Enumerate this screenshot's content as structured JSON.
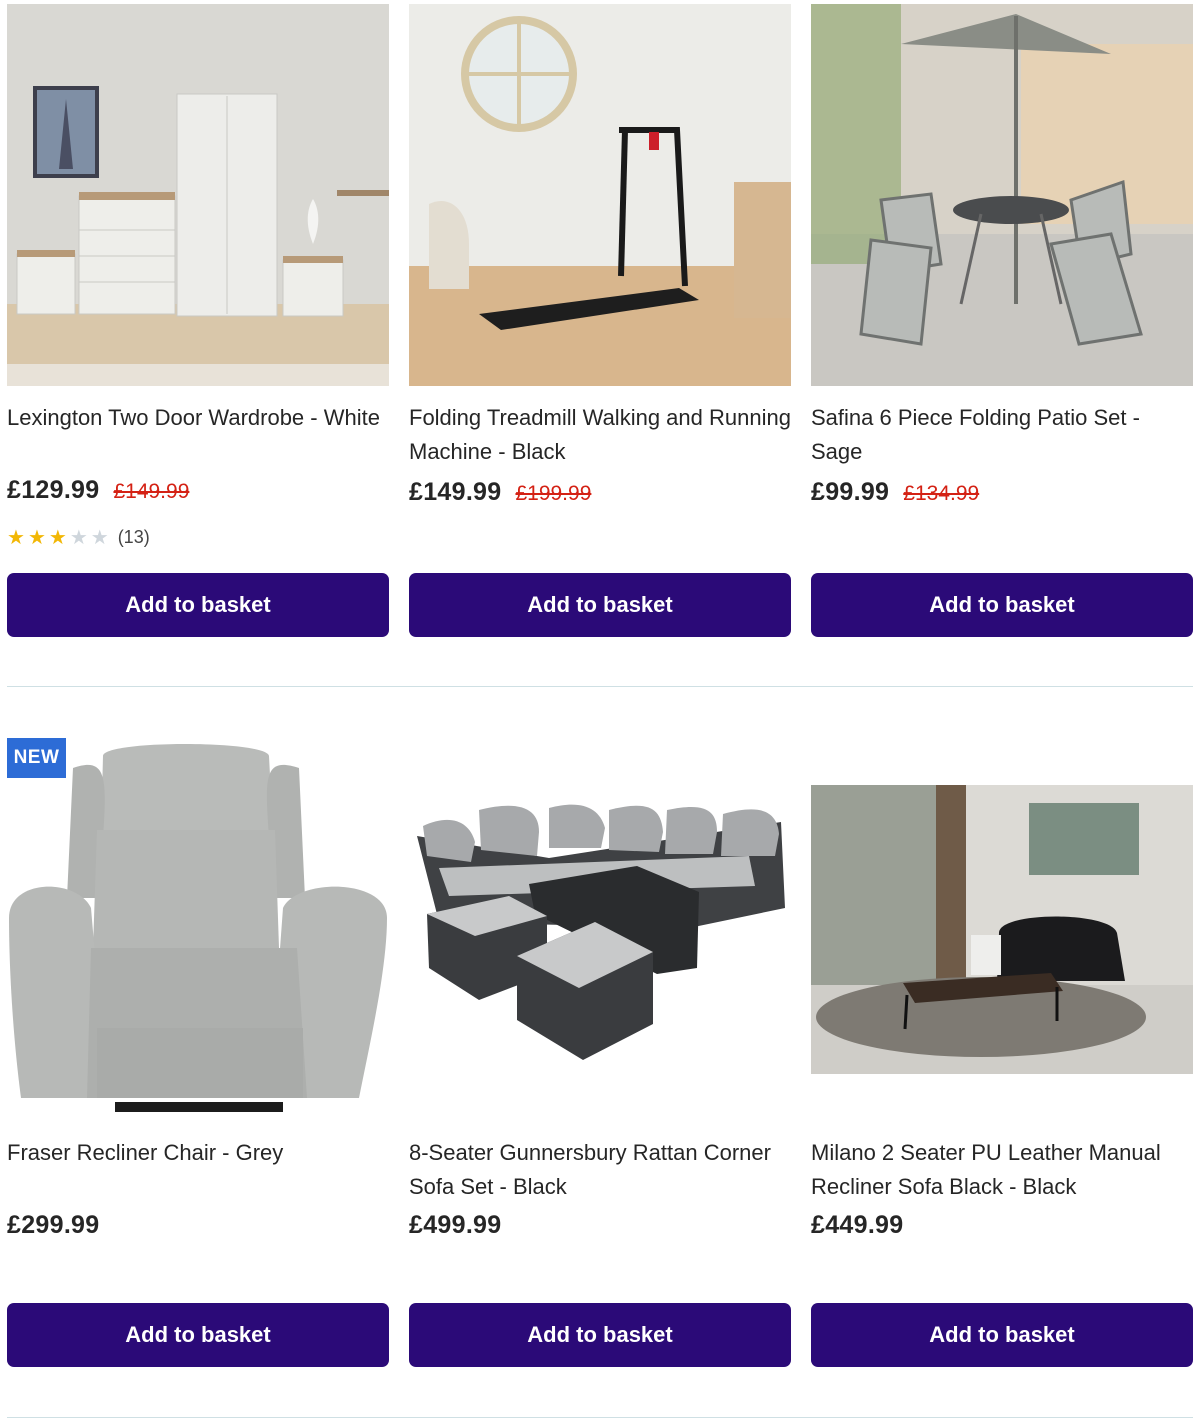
{
  "basket_label": "Add to basket",
  "products": [
    {
      "title": "Lexington Two Door Wardrobe - White",
      "price": "£129.99",
      "was_price": "£149.99",
      "rating": {
        "stars": 3,
        "max": 5,
        "count": "(13)"
      }
    },
    {
      "title": "Folding Treadmill Walking and Running Machine - Black",
      "price": "£149.99",
      "was_price": "£199.99"
    },
    {
      "title": "Safina 6 Piece Folding Patio Set - Sage",
      "price": "£99.99",
      "was_price": "£134.99"
    },
    {
      "title": "Fraser Recliner Chair - Grey",
      "price": "£299.99",
      "badge": "NEW"
    },
    {
      "title": "8-Seater Gunnersbury Rattan Corner Sofa Set - Black",
      "price": "£499.99"
    },
    {
      "title": "Milano 2 Seater PU Leather Manual Recliner Sofa Black - Black",
      "price": "£449.99"
    }
  ],
  "colors": {
    "button": "#2b0a78",
    "was_price": "#d42114",
    "badge": "#2d6cd6",
    "star_on": "#f2b705",
    "star_off": "#cfd6dc"
  }
}
